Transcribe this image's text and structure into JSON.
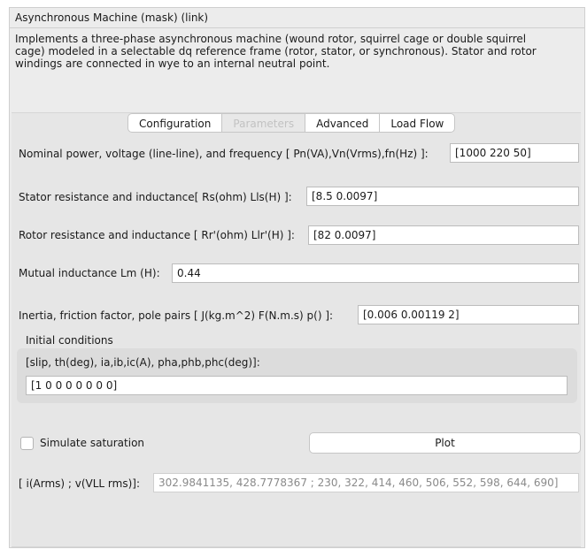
{
  "window": {
    "title": "Asynchronous Machine (mask) (link)",
    "description": "Implements a three-phase asynchronous machine (wound rotor, squirrel cage or double squirrel\ncage) modeled in a selectable dq reference frame (rotor, stator, or synchronous). Stator and rotor\nwindings are connected in wye to an internal neutral point."
  },
  "tabs": [
    {
      "label": "Configuration",
      "enabled": true
    },
    {
      "label": "Parameters",
      "enabled": false
    },
    {
      "label": "Advanced",
      "enabled": true
    },
    {
      "label": "Load Flow",
      "enabled": true
    }
  ],
  "params": {
    "nominal": {
      "label": "Nominal power, voltage (line-line), and frequency [ Pn(VA),Vn(Vrms),fn(Hz) ]:",
      "value": "[1000 220 50]"
    },
    "stator": {
      "label": "Stator resistance and inductance[ Rs(ohm)  Lls(H) ]:",
      "value": "[8.5 0.0097]"
    },
    "rotor": {
      "label": "Rotor resistance and inductance [ Rr'(ohm)  Llr'(H) ]:",
      "value": "[82 0.0097]"
    },
    "mutual": {
      "label": "Mutual inductance Lm (H):",
      "value": "0.44"
    },
    "inertia": {
      "label": "Inertia, friction factor, pole pairs [ J(kg.m^2)  F(N.m.s)  p() ]:",
      "value": "[0.006 0.00119 2]"
    }
  },
  "initial": {
    "heading": "Initial conditions",
    "label": "[slip, th(deg), ia,ib,ic(A), pha,phb,phc(deg)]:",
    "value": "[1 0 0 0 0 0 0 0]"
  },
  "saturation": {
    "label": "Simulate saturation",
    "checked": false
  },
  "plot_label": "Plot",
  "saturation_data": {
    "label": "[ i(Arms) ; v(VLL rms)]:",
    "value": "302.9841135, 428.7778367 ; 230, 322, 414, 460, 506, 552, 598, 644, 690]"
  }
}
